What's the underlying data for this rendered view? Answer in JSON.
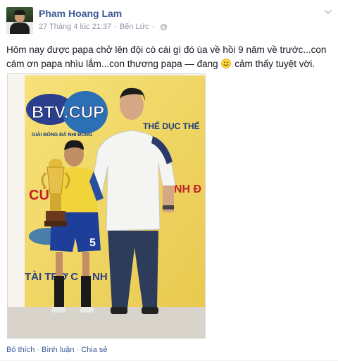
{
  "post": {
    "author": "Pham Hoang Lam",
    "timestamp": "27 Tháng 4 lúc 21:37",
    "location": "Bến Lức",
    "privacy_icon": "globe-icon",
    "menu_icon": "chevron-down-icon",
    "status_before_emoji": "Hôm nay được papa chở lên đội cò cái gì đó ùa về hồi 9 năm về trước...con cám ơn papa nhìu lắm...con thương papa — đang",
    "feeling_emoji": "smiley-icon",
    "status_after_emoji": "cảm thấy tuyệt vời.",
    "photo": {
      "banner_text": "BTV.CUP",
      "banner_subtext_1": "GIẢI BÓNG ĐÁ NHI ĐỒNG",
      "sign_text_1": "THỂ DỤC THỂ",
      "sign_text_2": "CÚ",
      "sign_text_3": "NH Đ",
      "sign_text_4": "TÀI TRỢ C",
      "sign_text_5": "NH",
      "jersey_number": "5"
    }
  },
  "actions": {
    "like": "Bỏ thích",
    "comment": "Bình luận",
    "share": "Chia sẻ",
    "separator": "·"
  },
  "colors": {
    "link": "#3b5998",
    "meta": "#9197a3",
    "text": "#141823"
  }
}
